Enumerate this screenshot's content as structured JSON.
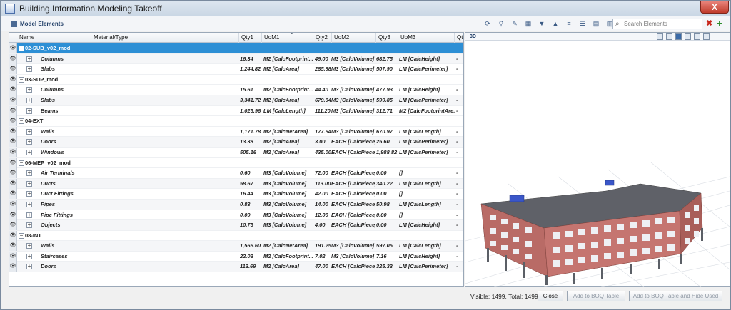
{
  "window": {
    "title": "Building Information Modeling Takeoff",
    "close_glyph": "X"
  },
  "toolbar": {
    "panel_title": "Model Elements",
    "search_placeholder": "Search Elements",
    "clear_glyph": "✖",
    "add_glyph": "+"
  },
  "grid": {
    "columns": [
      "Name",
      "Material/Type",
      "Qty1",
      "UoM1",
      "Qty2",
      "UoM2",
      "Qty3",
      "UoM3",
      "Qty"
    ],
    "sort_indicator": "1",
    "rows": [
      {
        "type": "group",
        "name": "02-SUB_v02_mod",
        "selected": true
      },
      {
        "type": "item",
        "name": "Columns",
        "qty1": "16.34",
        "uom1": "M2 [CalcFootprint...",
        "qty2": "49.00",
        "uom2": "M3 [CalcVolume]",
        "qty3": "682.75",
        "uom3": "LM [CalcHeight]",
        "qty4": "-"
      },
      {
        "type": "item",
        "name": "Slabs",
        "qty1": "1,244.82",
        "uom1": "M2 [CalcArea]",
        "qty2": "285.98",
        "uom2": "M3 [CalcVolume]",
        "qty3": "507.90",
        "uom3": "LM [CalcPerimeter]",
        "qty4": "-"
      },
      {
        "type": "group",
        "name": "03-SUP_mod",
        "selected": false
      },
      {
        "type": "item",
        "name": "Columns",
        "qty1": "15.61",
        "uom1": "M2 [CalcFootprint...",
        "qty2": "44.40",
        "uom2": "M3 [CalcVolume]",
        "qty3": "477.93",
        "uom3": "LM [CalcHeight]",
        "qty4": "-"
      },
      {
        "type": "item",
        "name": "Slabs",
        "qty1": "3,341.72",
        "uom1": "M2 [CalcArea]",
        "qty2": "679.04",
        "uom2": "M3 [CalcVolume]",
        "qty3": "599.85",
        "uom3": "LM [CalcPerimeter]",
        "qty4": "-"
      },
      {
        "type": "item",
        "name": "Beams",
        "qty1": "1,025.96",
        "uom1": "LM [CalcLength]",
        "qty2": "111.20",
        "uom2": "M3 [CalcVolume]",
        "qty3": "312.71",
        "uom3": "M2 [CalcFootprintAre...",
        "qty4": "-"
      },
      {
        "type": "group",
        "name": "04-EXT",
        "selected": false
      },
      {
        "type": "item",
        "name": "Walls",
        "qty1": "1,171.78",
        "uom1": "M2 [CalcNetArea]",
        "qty2": "177.64",
        "uom2": "M3 [CalcVolume]",
        "qty3": "670.97",
        "uom3": "LM [CalcLength]",
        "qty4": "-"
      },
      {
        "type": "item",
        "name": "Doors",
        "qty1": "13.38",
        "uom1": "M2 [CalcArea]",
        "qty2": "3.00",
        "uom2": "EACH [CalcPiece]",
        "qty3": "25.60",
        "uom3": "LM [CalcPerimeter]",
        "qty4": "-"
      },
      {
        "type": "item",
        "name": "Windows",
        "qty1": "505.16",
        "uom1": "M2 [CalcArea]",
        "qty2": "435.00",
        "uom2": "EACH [CalcPiece]",
        "qty3": "1,988.82",
        "uom3": "LM [CalcPerimeter]",
        "qty4": "-"
      },
      {
        "type": "group",
        "name": "06-MEP_v02_mod",
        "selected": false
      },
      {
        "type": "item",
        "name": "Air Terminals",
        "qty1": "0.60",
        "uom1": "M3 [CalcVolume]",
        "qty2": "72.00",
        "uom2": "EACH [CalcPiece]",
        "qty3": "0.00",
        "uom3": "[]",
        "qty4": "-"
      },
      {
        "type": "item",
        "name": "Ducts",
        "qty1": "58.67",
        "uom1": "M3 [CalcVolume]",
        "qty2": "113.00",
        "uom2": "EACH [CalcPiece]",
        "qty3": "340.22",
        "uom3": "LM [CalcLength]",
        "qty4": "-"
      },
      {
        "type": "item",
        "name": "Duct Fittings",
        "qty1": "16.44",
        "uom1": "M3 [CalcVolume]",
        "qty2": "42.00",
        "uom2": "EACH [CalcPiece]",
        "qty3": "0.00",
        "uom3": "[]",
        "qty4": "-"
      },
      {
        "type": "item",
        "name": "Pipes",
        "qty1": "0.83",
        "uom1": "M3 [CalcVolume]",
        "qty2": "14.00",
        "uom2": "EACH [CalcPiece]",
        "qty3": "50.98",
        "uom3": "LM [CalcLength]",
        "qty4": "-"
      },
      {
        "type": "item",
        "name": "Pipe Fittings",
        "qty1": "0.09",
        "uom1": "M3 [CalcVolume]",
        "qty2": "12.00",
        "uom2": "EACH [CalcPiece]",
        "qty3": "0.00",
        "uom3": "[]",
        "qty4": "-"
      },
      {
        "type": "item",
        "name": "Objects",
        "qty1": "10.75",
        "uom1": "M3 [CalcVolume]",
        "qty2": "4.00",
        "uom2": "EACH [CalcPiece]",
        "qty3": "0.00",
        "uom3": "LM [CalcHeight]",
        "qty4": "-"
      },
      {
        "type": "group",
        "name": "08-INT",
        "selected": false
      },
      {
        "type": "item",
        "name": "Walls",
        "qty1": "1,566.60",
        "uom1": "M2 [CalcNetArea]",
        "qty2": "191.25",
        "uom2": "M3 [CalcVolume]",
        "qty3": "597.05",
        "uom3": "LM [CalcLength]",
        "qty4": "-"
      },
      {
        "type": "item",
        "name": "Staircases",
        "qty1": "22.03",
        "uom1": "M2 [CalcFootprint...",
        "qty2": "7.02",
        "uom2": "M3 [CalcVolume]",
        "qty3": "7.16",
        "uom3": "LM [CalcHeight]",
        "qty4": "-"
      },
      {
        "type": "item",
        "name": "Doors",
        "qty1": "113.69",
        "uom1": "M2 [CalcArea]",
        "qty2": "47.00",
        "uom2": "EACH [CalcPiece]",
        "qty3": "325.33",
        "uom3": "LM [CalcPerimeter]",
        "qty4": "-"
      }
    ]
  },
  "view3d": {
    "label": "3D"
  },
  "footer": {
    "counts": "Visible: 1499, Total: 1499",
    "close_label": "Close",
    "add_boq_label": "Add to BOQ Table",
    "add_hide_label": "Add to BOQ Table and Hide Used"
  },
  "colors": {
    "selected_row": "#2d8fd5",
    "building_wall": "#b96b66",
    "building_roof": "#5f6168",
    "rooftop_unit": "#3a56c9"
  }
}
